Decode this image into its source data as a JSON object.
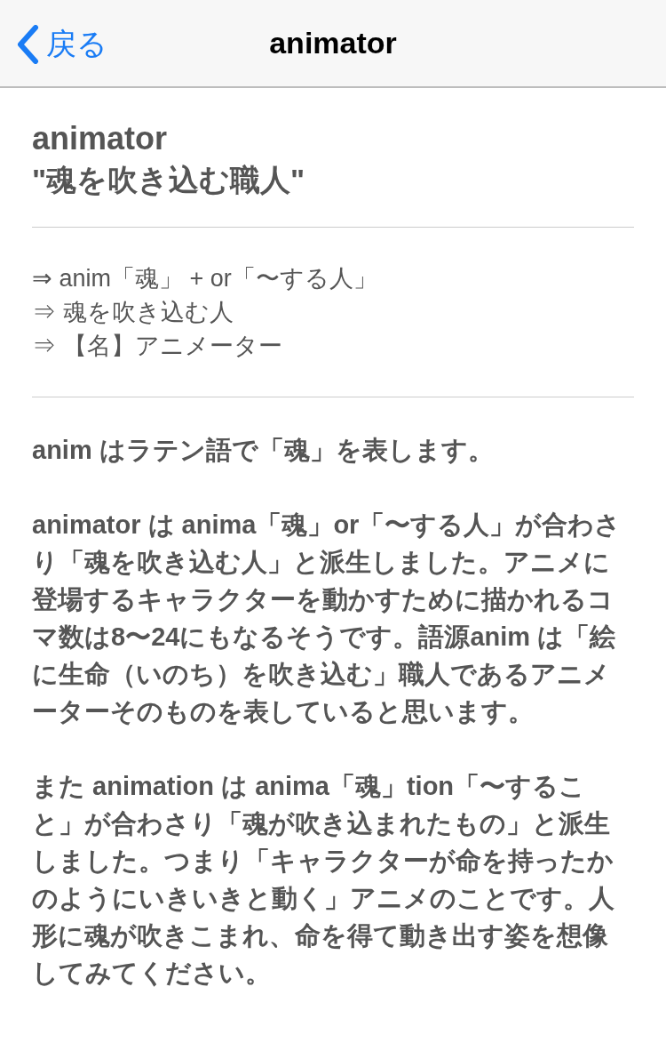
{
  "nav": {
    "back": "戻る",
    "title": "animator"
  },
  "heading": {
    "word": "animator",
    "meaning": "\"魂を吹き込む職人\""
  },
  "etymology": [
    "⇒ anim「魂」 + or「〜する人」",
    "⇒ 魂を吹き込む人",
    "⇒ 【名】アニメーター"
  ],
  "paragraphs": [
    "anim はラテン語で「魂」を表します。",
    "animator は anima「魂」or「〜する人」が合わさり「魂を吹き込む人」と派生しました。アニメに登場するキャラクターを動かすために描かれるコマ数は8〜24にもなるそうです。語源anim は「絵に生命（いのち）を吹き込む」職人であるアニメーターそのものを表していると思います。",
    "また animation は anima「魂」tion「〜すること」が合わさり「魂が吹き込まれたもの」と派生しました。つまり「キャラクターが命を持ったかのようにいきいきと動く」アニメのことです。人形に魂が吹きこまれ、命を得て動き出す姿を想像してみてください。"
  ]
}
